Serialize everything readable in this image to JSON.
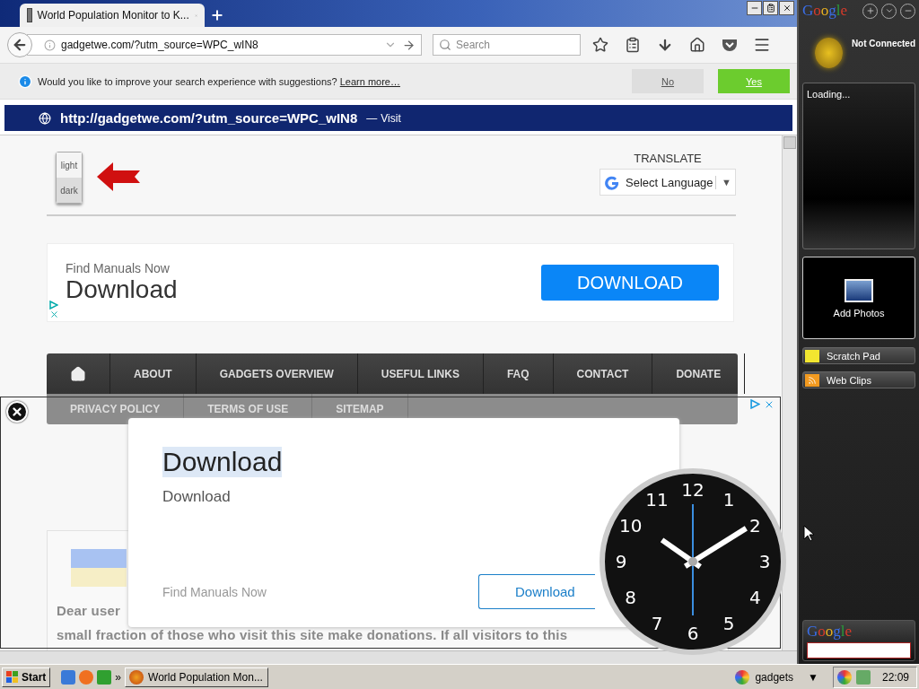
{
  "browser": {
    "tabs": [
      {
        "title": "World Population Monitor to K...",
        "selected": true
      }
    ],
    "address": {
      "value": "gadgetwe.com/?utm_source=WPC_wIN8"
    },
    "search": {
      "placeholder": "Search"
    },
    "notification": {
      "message": "Would you like to improve your search experience with suggestions?",
      "link": "Learn more…",
      "buttons": [
        {
          "label": "No",
          "kind": "secondary"
        },
        {
          "label": "Yes",
          "kind": "primary"
        }
      ]
    },
    "suggestion": {
      "url": "http://gadgetwe.com/?utm_source=WPC_wIN8",
      "separator": "—",
      "action": "Visit"
    }
  },
  "page": {
    "theme_toggle": [
      {
        "label": "light",
        "selected": false
      },
      {
        "label": "dark",
        "selected": true
      }
    ],
    "translate": {
      "title": "TRANSLATE",
      "select": "Select Language",
      "caret": "▼"
    },
    "banner_ad": {
      "kicker": "Find Manuals Now",
      "headline": "Download",
      "button": "DOWNLOAD"
    },
    "nav": {
      "primary": [
        {
          "kind": "home"
        },
        {
          "kind": "link",
          "label": "ABOUT"
        },
        {
          "kind": "link",
          "label": "GADGETS OVERVIEW"
        },
        {
          "kind": "link",
          "label": "USEFUL LINKS"
        },
        {
          "kind": "link",
          "label": "FAQ"
        },
        {
          "kind": "link",
          "label": "CONTACT"
        },
        {
          "kind": "link",
          "label": "DONATE"
        }
      ],
      "secondary": [
        {
          "kind": "link",
          "label": "PRIVACY POLICY"
        },
        {
          "kind": "link",
          "label": "TERMS OF USE"
        },
        {
          "kind": "link",
          "label": "SITEMAP"
        }
      ]
    },
    "donation": {
      "lines": [
        "Dear user",
        "small fraction of those who visit this site make donations. If all visitors to this"
      ]
    }
  },
  "overlay_ad": {
    "headline": "Download",
    "subtitle": "Download",
    "source": "Find Manuals Now",
    "button": "Download"
  },
  "clock": {
    "numerals": [
      "12",
      "1",
      "2",
      "3",
      "4",
      "5",
      "6",
      "7",
      "8",
      "9",
      "10",
      "11"
    ]
  },
  "sidebar": {
    "logo": "Google",
    "status": "Not Connected",
    "loading": "Loading...",
    "photos": "Add Photos",
    "buttons": [
      {
        "label": "Scratch Pad",
        "kind": "notes"
      },
      {
        "label": "Web Clips",
        "kind": "rss"
      }
    ],
    "search_logo": "Google"
  },
  "taskbar": {
    "start": "Start",
    "more": "»",
    "tasks": [
      {
        "label": "World Population Mon..."
      }
    ],
    "toolbar": "gadgets",
    "caret": "▼",
    "time": "22:09"
  }
}
